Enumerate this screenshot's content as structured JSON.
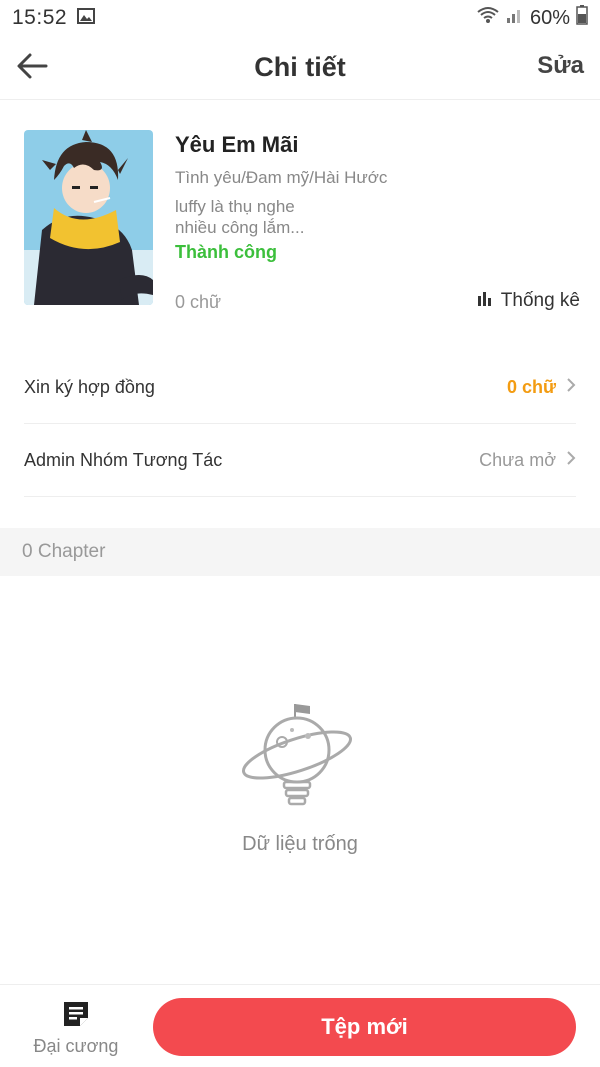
{
  "status_bar": {
    "time": "15:52",
    "battery": "60%",
    "icons": [
      "image-icon",
      "wifi-icon",
      "signal-icon",
      "battery-icon"
    ]
  },
  "header": {
    "title": "Chi tiết",
    "edit_label": "Sửa",
    "back_icon": "arrow-left-icon"
  },
  "book": {
    "title": "Yêu Em Mãi",
    "genre": "Tình yêu/Đam mỹ/Hài Hước",
    "description_line1": "luffy là thụ nghe",
    "description_line2": "nhiều công lắm...",
    "status": "Thành công",
    "word_count": "0 chữ",
    "stats_label": "Thống kê"
  },
  "rows": [
    {
      "label": "Xin ký hợp đồng",
      "value": "0 chữ"
    },
    {
      "label": "Admin Nhóm Tương Tác",
      "value": "Chưa mở"
    }
  ],
  "chapters": {
    "count_label": "0 Chapter",
    "empty_text": "Dữ liệu trống"
  },
  "bottom": {
    "outline_label": "Đại cương",
    "new_button_label": "Tệp mới"
  },
  "colors": {
    "accent": "#f34a4f",
    "success": "#3cbf3c",
    "orange": "#f39c12",
    "muted": "#999999"
  }
}
